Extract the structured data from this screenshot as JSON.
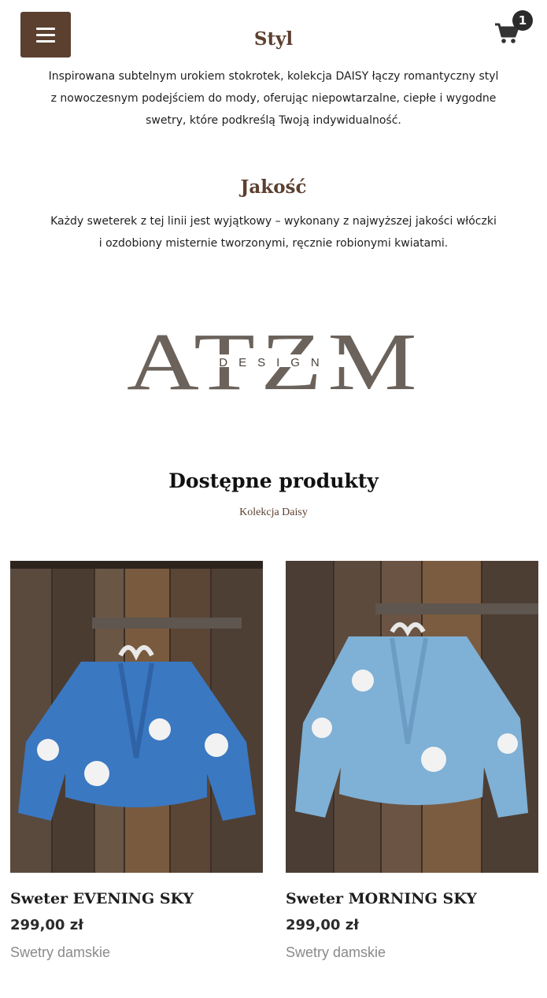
{
  "header": {
    "menu_icon": "hamburger-icon",
    "cart_icon": "shopping-cart-icon",
    "cart_count": "1"
  },
  "styl": {
    "title": "Styl",
    "text": "Inspirowana subtelnym urokiem stokrotek, kolekcja DAISY łączy romantyczny styl z nowoczesnym podejściem do mody, oferując niepowtarzalne, ciepłe i wygodne swetry, które podkreślą Twoją indywidualność."
  },
  "jakosc": {
    "title": "Jakość",
    "text": "Każdy sweterek z tej linii jest wyjątkowy – wykonany z najwyższej jakości włóczki i ozdobiony misternie tworzonymi, ręcznie robionymi kwiatami."
  },
  "logo": {
    "main": "ATZM",
    "sub": "DESIGN"
  },
  "products": {
    "title": "Dostępne produkty",
    "subtitle": "Kolekcja Daisy",
    "items": [
      {
        "name": "Sweter EVENING SKY",
        "price": "299,00 zł",
        "category": "Swetry damskie",
        "sweater_color": "#3a78c2"
      },
      {
        "name": "Sweter MORNING SKY",
        "price": "299,00 zł",
        "category": "Swetry damskie",
        "sweater_color": "#7fb0d6"
      }
    ]
  },
  "colors": {
    "brand_brown": "#5b4030",
    "logo_gray": "#6b625b"
  }
}
